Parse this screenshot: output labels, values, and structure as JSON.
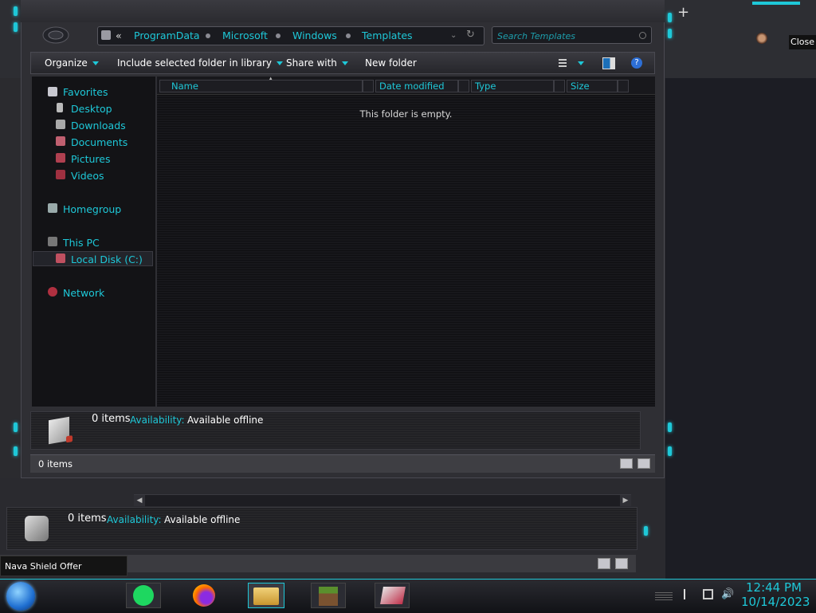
{
  "explorer": {
    "breadcrumb": {
      "overflow": "«",
      "items": [
        "ProgramData",
        "Microsoft",
        "Windows",
        "Templates"
      ]
    },
    "search": {
      "placeholder": "Search Templates"
    },
    "toolbar": {
      "organize": "Organize",
      "include_in_library": "Include selected folder in library",
      "share_with": "Share with",
      "new_folder": "New folder"
    },
    "nav": {
      "favorites": "Favorites",
      "favorites_items": [
        "Desktop",
        "Downloads",
        "Documents",
        "Pictures",
        "Videos"
      ],
      "homegroup": "Homegroup",
      "this_pc": "This PC",
      "local_disk": "Local Disk (C:)",
      "network": "Network"
    },
    "columns": [
      "Name",
      "Date modified",
      "Type",
      "Size"
    ],
    "empty_message": "This folder is empty.",
    "details": {
      "count": "0 items",
      "availability_label": "Availability:",
      "availability_value": "Available offline"
    },
    "status": "0 items"
  },
  "background_explorer": {
    "details": {
      "count": "0 items",
      "availability_label": "Availability:",
      "availability_value": "Available offline"
    }
  },
  "tooltip": "Nava Shield Offer",
  "close_tooltip": "Close",
  "taskbar": {
    "time": "12:44 PM",
    "date": "10/14/2023"
  },
  "colors": {
    "accent": "#1ec8d8",
    "window": "#2f2f34",
    "content": "#131316"
  }
}
